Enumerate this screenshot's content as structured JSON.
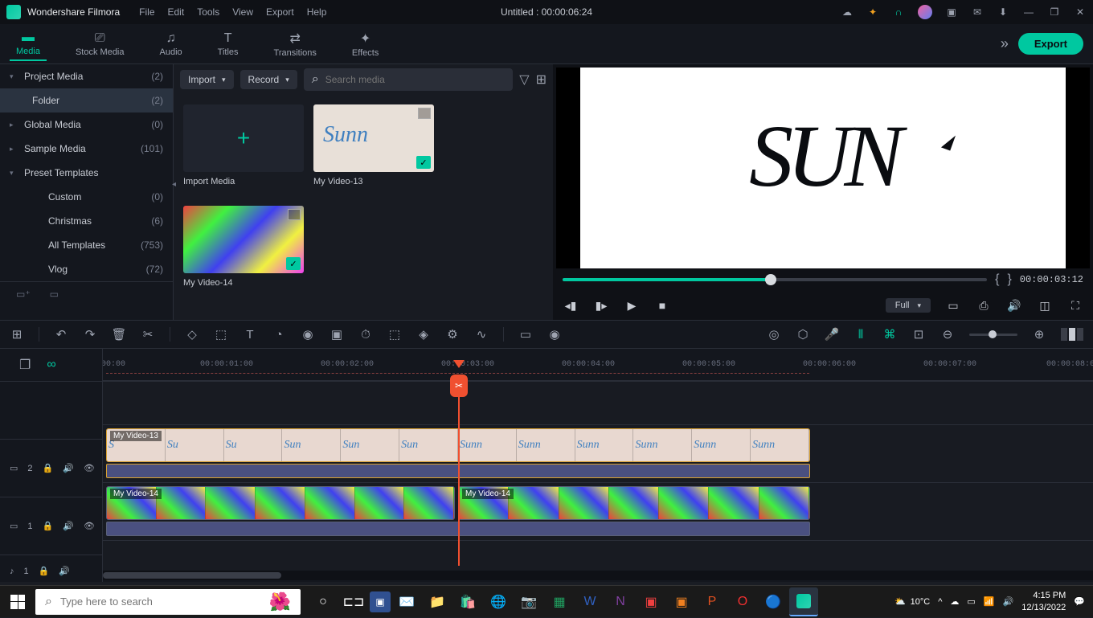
{
  "app": {
    "name": "Wondershare Filmora",
    "title": "Untitled : 00:00:06:24"
  },
  "menu": [
    "File",
    "Edit",
    "Tools",
    "View",
    "Export",
    "Help"
  ],
  "tabs": [
    {
      "label": "Media",
      "active": true
    },
    {
      "label": "Stock Media"
    },
    {
      "label": "Audio"
    },
    {
      "label": "Titles"
    },
    {
      "label": "Transitions"
    },
    {
      "label": "Effects"
    }
  ],
  "export_btn": "Export",
  "sidebar": {
    "items": [
      {
        "label": "Project Media",
        "count": "(2)",
        "chev": "▾"
      },
      {
        "label": "Folder",
        "count": "(2)",
        "selected": true,
        "sub": true
      },
      {
        "label": "Global Media",
        "count": "(0)",
        "chev": "▸"
      },
      {
        "label": "Sample Media",
        "count": "(101)",
        "chev": "▸"
      },
      {
        "label": "Preset Templates",
        "count": "",
        "chev": "▾"
      },
      {
        "label": "Custom",
        "count": "(0)",
        "sub2": true
      },
      {
        "label": "Christmas",
        "count": "(6)",
        "sub2": true
      },
      {
        "label": "All Templates",
        "count": "(753)",
        "sub2": true
      },
      {
        "label": "Vlog",
        "count": "(72)",
        "sub2": true
      }
    ]
  },
  "media_toolbar": {
    "import": "Import",
    "record": "Record",
    "search_ph": "Search media"
  },
  "media_items": [
    {
      "label": "Import Media",
      "import": true
    },
    {
      "label": "My Video-13",
      "check": true,
      "sun": true
    },
    {
      "label": "My Video-14",
      "check": true,
      "colorful": true
    }
  ],
  "preview": {
    "timecode": "00:00:03:12",
    "quality": "Full",
    "brackets": {
      "l": "{",
      "r": "}"
    }
  },
  "ruler": [
    ":00:00",
    "00:00:01:00",
    "00:00:02:00",
    "00:00:03:00",
    "00:00:04:00",
    "00:00:05:00",
    "00:00:06:00",
    "00:00:07:00",
    "00:00:08:0"
  ],
  "clips": {
    "c1": "My Video-13",
    "c2": "My Video-14",
    "c3": "My Video-14"
  },
  "track_heads": {
    "v2": "2",
    "v1": "1",
    "a1": "1"
  },
  "taskbar": {
    "search_ph": "Type here to search",
    "weather": "10°C",
    "time": "4:15 PM",
    "date": "12/13/2022"
  }
}
